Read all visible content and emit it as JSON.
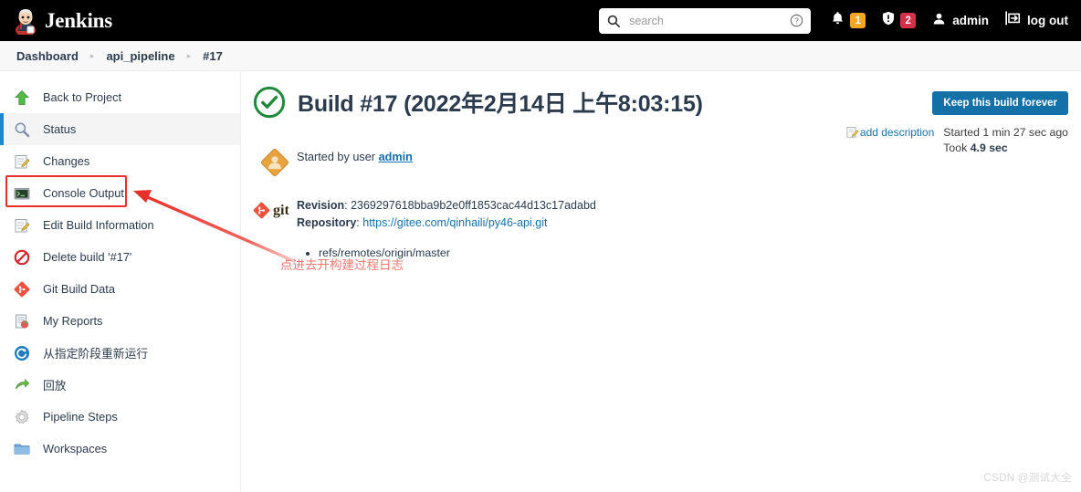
{
  "header": {
    "brand": "Jenkins",
    "brand_logo_icon": "jenkins-butler-logo",
    "search": {
      "placeholder": "search",
      "value": "",
      "search_icon": "search-icon",
      "help_icon": "help-circle-icon"
    },
    "notifications": {
      "bell_icon": "bell-icon",
      "bell_count": "1",
      "bell_color": "#f5a623",
      "security_icon": "shield-exclamation-icon",
      "security_count": "2",
      "security_color": "#d4304a"
    },
    "user": {
      "icon": "person-icon",
      "label": "admin"
    },
    "logout": {
      "icon": "logout-arrow-icon",
      "label": "log out"
    }
  },
  "breadcrumb": {
    "items": [
      {
        "label": "Dashboard"
      },
      {
        "label": "api_pipeline"
      },
      {
        "label": "#17"
      }
    ],
    "separator": "▸"
  },
  "sidebar": {
    "items": [
      {
        "label": "Back to Project",
        "icon": "up-arrow-green-icon",
        "active": false
      },
      {
        "label": "Status",
        "icon": "magnifier-icon",
        "active": true
      },
      {
        "label": "Changes",
        "icon": "notepad-pencil-icon",
        "active": false
      },
      {
        "label": "Console Output",
        "icon": "terminal-icon",
        "active": false
      },
      {
        "label": "Edit Build Information",
        "icon": "notepad-pencil-icon",
        "active": false
      },
      {
        "label": "Delete build '#17'",
        "icon": "no-entry-icon",
        "active": false
      },
      {
        "label": "Git Build Data",
        "icon": "git-diamond-icon",
        "active": false
      },
      {
        "label": "My Reports",
        "icon": "report-chart-icon",
        "active": false
      },
      {
        "label": "从指定阶段重新运行",
        "icon": "blue-refresh-icon",
        "active": false
      },
      {
        "label": "回放",
        "icon": "green-replay-arrow-icon",
        "active": false
      },
      {
        "label": "Pipeline Steps",
        "icon": "gear-icon",
        "active": false
      },
      {
        "label": "Workspaces",
        "icon": "folder-icon",
        "active": false
      }
    ]
  },
  "main": {
    "status_icon": "success-check-circle-icon",
    "status_color": "#1f8a3b",
    "title": "Build #17 (2022年2月14日 上午8:03:15)",
    "keep_button": "Keep this build forever",
    "keep_button_color": "#1471a8",
    "add_description": {
      "icon": "edit-description-icon",
      "label": "add description"
    },
    "started_ago": "Started 1 min 27 sec ago",
    "took_prefix": "Took ",
    "took_value": "4.9 sec",
    "cause": {
      "icon": "user-diamond-icon",
      "prefix": "Started by user ",
      "user": "admin"
    },
    "git": {
      "logo_icon": "git-logo-icon",
      "logo_word": "git",
      "revision_label": "Revision",
      "revision_value": "2369297618bba9b2e0ff1853cac44d13c17adabd",
      "repository_label": "Repository",
      "repository_value": "https://gitee.com/qinhaili/py46-api.git",
      "refs": [
        "refs/remotes/origin/master"
      ]
    }
  },
  "annotations": {
    "highlight_color": "#e8302a",
    "arrow_color": "#e8302a",
    "note_text": "点进去开构建过程日志",
    "note_color": "#f4786f",
    "watermark": "CSDN @测试大全"
  }
}
